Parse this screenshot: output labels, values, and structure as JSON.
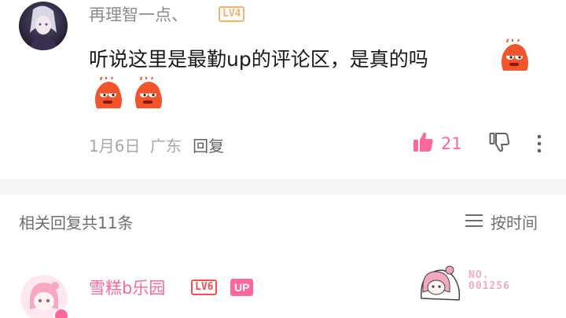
{
  "comment": {
    "username": "再理智一点、",
    "level": "LV4",
    "text": "听说这里是最勤up的评论区，是真的吗",
    "date": "1月6日",
    "location": "广东",
    "reply_label": "回复",
    "like_count": "21"
  },
  "replies_section": {
    "header": "相关回复共11条",
    "sort_label": "按时间"
  },
  "reply": {
    "username": "雪糕b乐园",
    "level": "LV6",
    "up_badge": "UP",
    "fan_label": "NO.",
    "fan_number": "001256"
  },
  "colors": {
    "accent_pink": "#ff6699",
    "lv4_orange": "#f5b26b",
    "lv6_red": "#ff4b4b"
  }
}
